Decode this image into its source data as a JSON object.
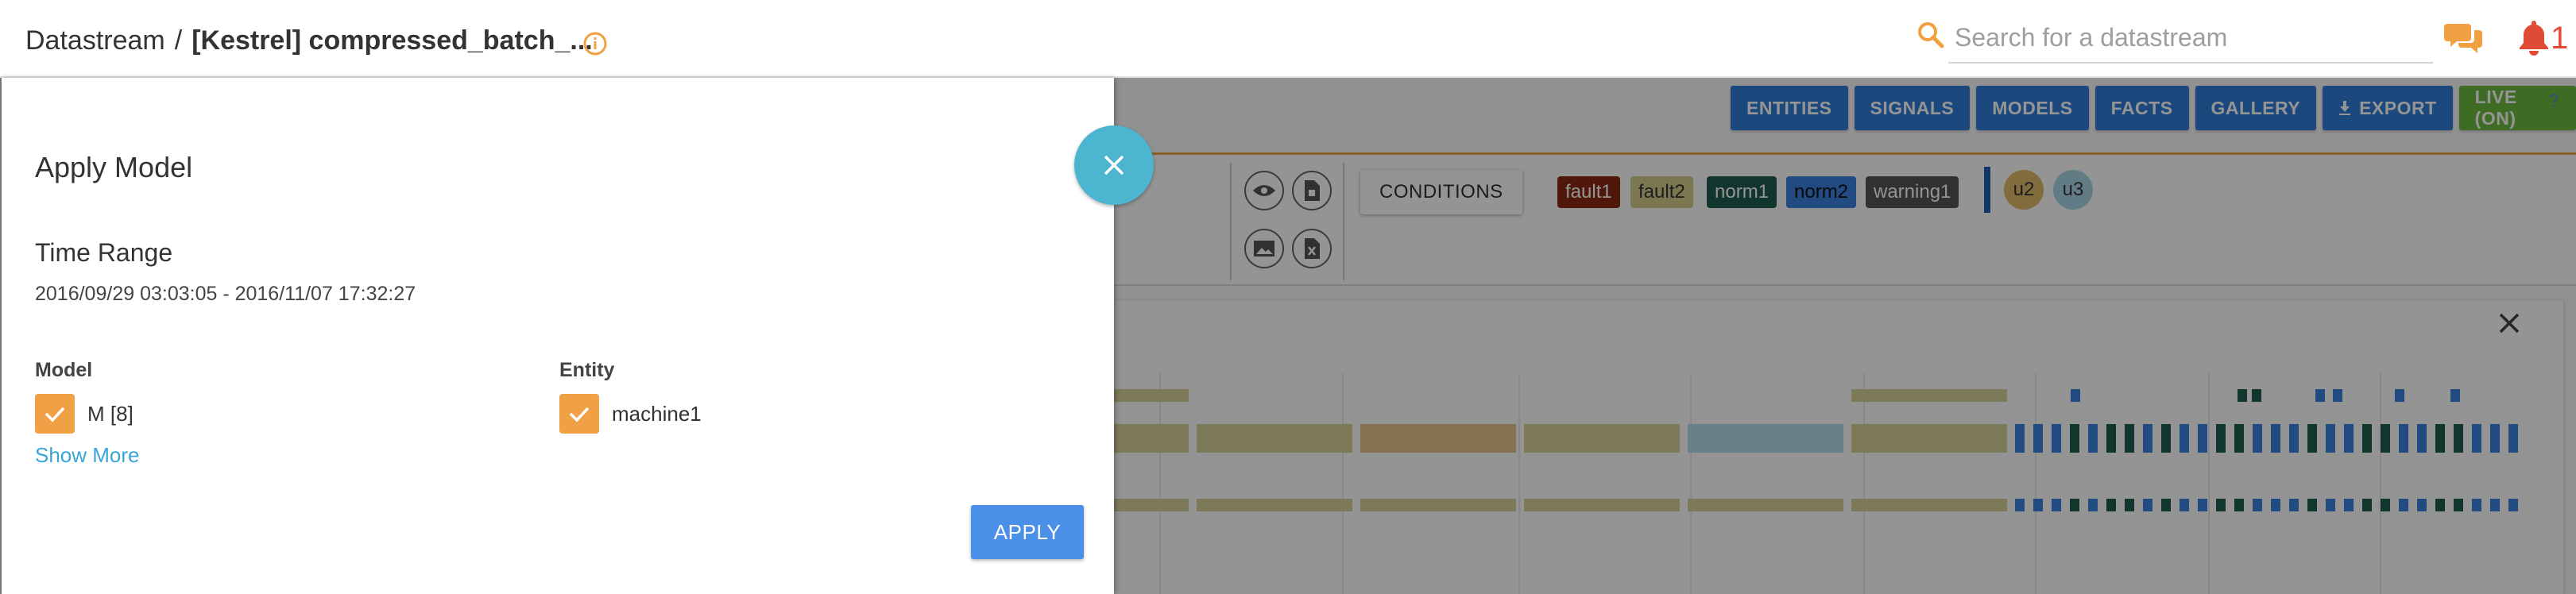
{
  "header": {
    "breadcrumb_root": "Datastream",
    "breadcrumb_sep": "/",
    "breadcrumb_current": "[Kestrel] compressed_batch_...",
    "search_placeholder": "Search for a datastream",
    "notification_count": "1"
  },
  "toolbar": {
    "entities": "ENTITIES",
    "signals": "SIGNALS",
    "models": "MODELS",
    "facts": "FACTS",
    "gallery": "GALLERY",
    "export": "EXPORT",
    "live": "LIVE (ON)",
    "help": "?"
  },
  "conditions_label": "CONDITIONS",
  "tags": [
    {
      "label": "fault1",
      "bg": "#8b2a12",
      "fg": "#ffffff"
    },
    {
      "label": "fault2",
      "bg": "#d4cf8c",
      "fg": "#333333"
    },
    {
      "label": "norm1",
      "bg": "#1e5e4e",
      "fg": "#ffffff"
    },
    {
      "label": "norm2",
      "bg": "#3b82e0",
      "fg": "#111111"
    },
    {
      "label": "warning1",
      "bg": "#555555",
      "fg": "#ffffff"
    }
  ],
  "user_circles": [
    {
      "label": "u2",
      "bg": "#e0b86a"
    },
    {
      "label": "u3",
      "bg": "#a8d6e6"
    }
  ],
  "drawer": {
    "title": "Apply Model",
    "time_range_label": "Time Range",
    "time_range_value": "2016/09/29 03:03:05 - 2016/11/07 17:32:27",
    "model_label": "Model",
    "model_item": "M [8]",
    "entity_label": "Entity",
    "entity_item": "machine1",
    "show_more": "Show More",
    "apply": "APPLY"
  },
  "colors": {
    "accent_teal": "#4cb5cf",
    "checkbox_orange": "#f0a045",
    "apply_blue": "#4a8fe8",
    "toolbar_blue": "#2f7ed8",
    "live_green": "#6dba3e",
    "link_blue": "#3aa6d8"
  },
  "icons": {
    "info": "info-icon",
    "search": "search-icon",
    "chat": "chat-icon",
    "bell": "bell-icon",
    "close": "close-icon",
    "check": "check-icon",
    "eye": "eye-icon",
    "file": "file-icon",
    "image": "image-icon",
    "download": "download-icon"
  }
}
